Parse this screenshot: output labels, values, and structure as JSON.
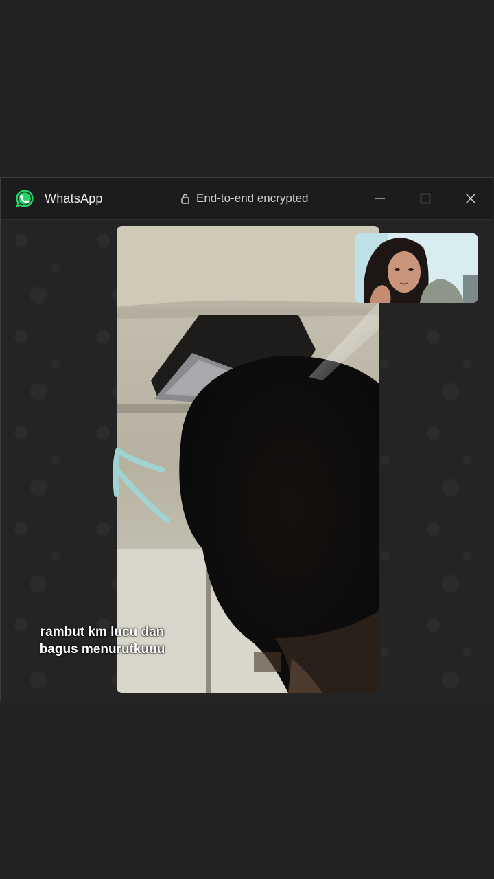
{
  "window": {
    "app_title": "WhatsApp",
    "encryption_label": "End-to-end encrypted",
    "controls": [
      "minimize-icon",
      "maximize-icon",
      "close-icon"
    ]
  },
  "call": {
    "remote_video": "remote-participant-video",
    "self_video": "self-preview-video"
  },
  "annotation": {
    "line1": "rambut km lucu dan",
    "line2": "bagus menurutkuuu",
    "arrow_color": "#9fd4d2"
  },
  "colors": {
    "whatsapp_green": "#25d366",
    "background": "#232323",
    "titlebar": "#1c1c1c"
  }
}
